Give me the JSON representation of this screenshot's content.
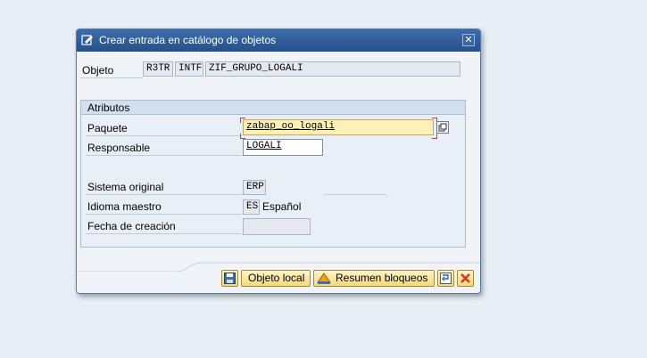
{
  "dialog": {
    "title": "Crear entrada en catálogo de objetos",
    "close_symbol": "✕"
  },
  "objeto": {
    "label": "Objeto",
    "pgmid": "R3TR",
    "type": "INTF",
    "name": "ZIF_GRUPO_LOGALI"
  },
  "atributos": {
    "group_title": "Atributos",
    "paquete": {
      "label": "Paquete",
      "value": "zabap_oo_logali"
    },
    "responsable": {
      "label": "Responsable",
      "value": "LOGALI"
    },
    "sistema_original": {
      "label": "Sistema original",
      "value": "ERP"
    },
    "idioma_maestro": {
      "label": "Idioma maestro",
      "value": "ES",
      "text": "Español"
    },
    "fecha_creacion": {
      "label": "Fecha de creación",
      "value": ""
    }
  },
  "toolbar": {
    "objeto_local_label": "Objeto local",
    "resumen_bloqueos_label": "Resumen bloqueos"
  },
  "icons": {
    "title": "edit-entry-icon",
    "search_help": "search-help-icon",
    "save": "save-icon",
    "local": "hat-icon",
    "other": "other-object-icon",
    "cancel": "cancel-icon"
  },
  "colors": {
    "title_bar": "#2c5a96",
    "required_field": "#fdf1b8",
    "button": "#f4d97a",
    "cancel": "#d93a1e"
  }
}
